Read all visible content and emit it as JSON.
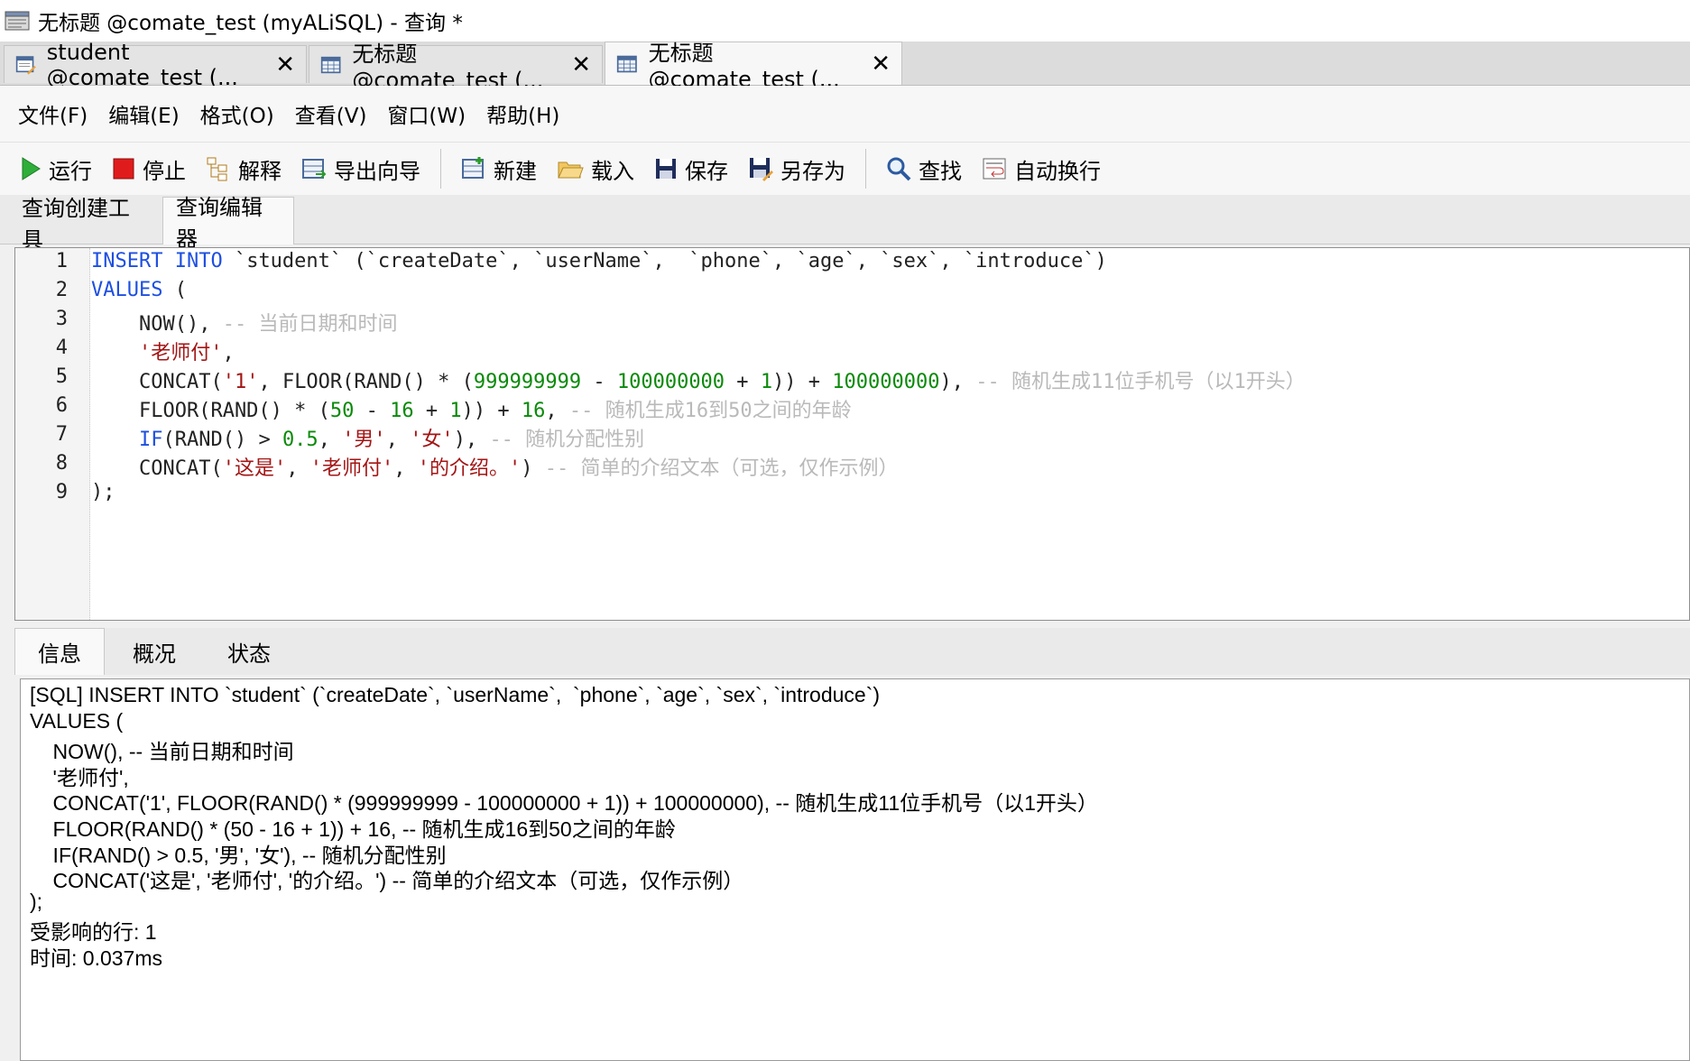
{
  "window": {
    "title": "无标题 @comate_test (myALiSQL) - 查询 *"
  },
  "doc_tabs": [
    {
      "label": "student @comate_test (...",
      "active": false
    },
    {
      "label": "无标题 @comate_test (...",
      "active": false
    },
    {
      "label": "无标题 @comate_test (...",
      "active": true
    }
  ],
  "close_glyph": "✕",
  "menu": [
    "文件(F)",
    "编辑(E)",
    "格式(O)",
    "查看(V)",
    "窗口(W)",
    "帮助(H)"
  ],
  "toolbar": {
    "run": "运行",
    "stop": "停止",
    "explain": "解释",
    "export_wizard": "导出向导",
    "new": "新建",
    "load": "载入",
    "save": "保存",
    "save_as": "另存为",
    "find": "查找",
    "word_wrap": "自动换行"
  },
  "subtabs": [
    "查询创建工具",
    "查询编辑器"
  ],
  "editor": {
    "line_numbers": [
      "1",
      "2",
      "3",
      "4",
      "5",
      "6",
      "7",
      "8",
      "9"
    ],
    "lines": [
      [
        {
          "t": "kw",
          "v": "INSERT INTO"
        },
        {
          "t": "p",
          "v": " `student` (`createDate`, `userName`,  `phone`, `age`, `sex`, `introduce`)"
        }
      ],
      [
        {
          "t": "kw",
          "v": "VALUES"
        },
        {
          "t": "p",
          "v": " ("
        }
      ],
      [
        {
          "t": "p",
          "v": "    NOW(), "
        },
        {
          "t": "cmt",
          "v": "-- 当前日期和时间"
        }
      ],
      [
        {
          "t": "p",
          "v": "    "
        },
        {
          "t": "str",
          "v": "'老师付'"
        },
        {
          "t": "p",
          "v": ","
        }
      ],
      [
        {
          "t": "p",
          "v": "    CONCAT("
        },
        {
          "t": "str",
          "v": "'1'"
        },
        {
          "t": "p",
          "v": ", FLOOR(RAND() * ("
        },
        {
          "t": "num",
          "v": "999999999"
        },
        {
          "t": "p",
          "v": " - "
        },
        {
          "t": "num",
          "v": "100000000"
        },
        {
          "t": "p",
          "v": " + "
        },
        {
          "t": "num",
          "v": "1"
        },
        {
          "t": "p",
          "v": ")) + "
        },
        {
          "t": "num",
          "v": "100000000"
        },
        {
          "t": "p",
          "v": "), "
        },
        {
          "t": "cmt",
          "v": "-- 随机生成11位手机号（以1开头）"
        }
      ],
      [
        {
          "t": "p",
          "v": "    FLOOR(RAND() * ("
        },
        {
          "t": "num",
          "v": "50"
        },
        {
          "t": "p",
          "v": " - "
        },
        {
          "t": "num",
          "v": "16"
        },
        {
          "t": "p",
          "v": " + "
        },
        {
          "t": "num",
          "v": "1"
        },
        {
          "t": "p",
          "v": ")) + "
        },
        {
          "t": "num",
          "v": "16"
        },
        {
          "t": "p",
          "v": ", "
        },
        {
          "t": "cmt",
          "v": "-- 随机生成16到50之间的年龄"
        }
      ],
      [
        {
          "t": "p",
          "v": "    "
        },
        {
          "t": "kw",
          "v": "IF"
        },
        {
          "t": "p",
          "v": "(RAND() > "
        },
        {
          "t": "num",
          "v": "0.5"
        },
        {
          "t": "p",
          "v": ", "
        },
        {
          "t": "str",
          "v": "'男'"
        },
        {
          "t": "p",
          "v": ", "
        },
        {
          "t": "str",
          "v": "'女'"
        },
        {
          "t": "p",
          "v": "), "
        },
        {
          "t": "cmt",
          "v": "-- 随机分配性别"
        }
      ],
      [
        {
          "t": "p",
          "v": "    CONCAT("
        },
        {
          "t": "str",
          "v": "'这是'"
        },
        {
          "t": "p",
          "v": ", "
        },
        {
          "t": "str",
          "v": "'老师付'"
        },
        {
          "t": "p",
          "v": ", "
        },
        {
          "t": "str",
          "v": "'的介绍。'"
        },
        {
          "t": "p",
          "v": ") "
        },
        {
          "t": "cmt",
          "v": "-- 简单的介绍文本（可选，仅作示例）"
        }
      ],
      [
        {
          "t": "p",
          "v": ");"
        }
      ]
    ]
  },
  "message_tabs": [
    "信息",
    "概况",
    "状态"
  ],
  "output_lines": [
    "[SQL] INSERT INTO `student` (`createDate`, `userName`,  `phone`, `age`, `sex`, `introduce`)",
    "VALUES (",
    "    NOW(), -- 当前日期和时间",
    "    '老师付',",
    "    CONCAT('1', FLOOR(RAND() * (999999999 - 100000000 + 1)) + 100000000), -- 随机生成11位手机号（以1开头）",
    "    FLOOR(RAND() * (50 - 16 + 1)) + 16, -- 随机生成16到50之间的年龄",
    "    IF(RAND() > 0.5, '男', '女'), -- 随机分配性别",
    "    CONCAT('这是', '老师付', '的介绍。') -- 简单的介绍文本（可选，仅作示例）",
    ");",
    "受影响的行: 1",
    "时间: 0.037ms"
  ]
}
